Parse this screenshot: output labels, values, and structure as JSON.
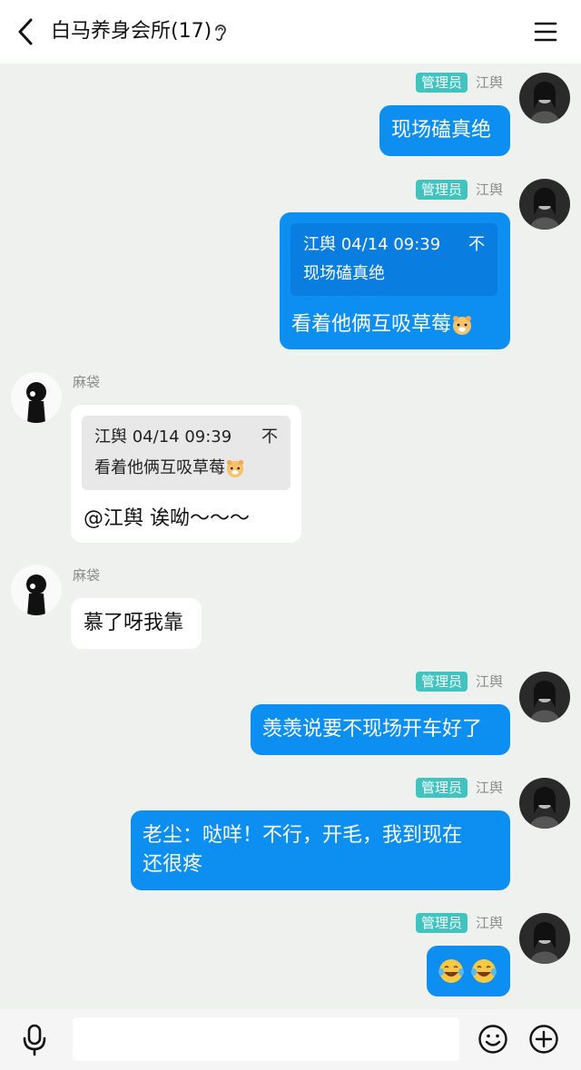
{
  "header": {
    "title": "白马养身会所(17)"
  },
  "messages": [
    {
      "sender": "江舆",
      "badge": "管理员",
      "text": "现场磕真绝"
    },
    {
      "sender": "江舆",
      "badge": "管理员",
      "quote_author": "江舆 04/14 09:39",
      "quote_text": "现场磕真绝",
      "quote_mark": "不",
      "text": "看着他俩互吸草莓"
    },
    {
      "sender": "麻袋",
      "quote_author": "江舆 04/14 09:39",
      "quote_text": "看着他俩互吸草莓",
      "quote_mark": "不",
      "text": "@江舆 诶呦～～～"
    },
    {
      "sender": "麻袋",
      "text": "慕了呀我靠"
    },
    {
      "sender": "江舆",
      "badge": "管理员",
      "text": "羡羡说要不现场开车好了"
    },
    {
      "sender": "江舆",
      "badge": "管理员",
      "text_line1": "老尘：哒咩！不行，开毛，我到现在",
      "text_line2": "还很疼"
    },
    {
      "sender": "江舆",
      "badge": "管理员",
      "emoji": "laughing-tears-emoji x2"
    }
  ],
  "colors": {
    "my_bubble": "#0c8ff0",
    "badge": "#41c4c0",
    "background": "#eef1ed"
  }
}
